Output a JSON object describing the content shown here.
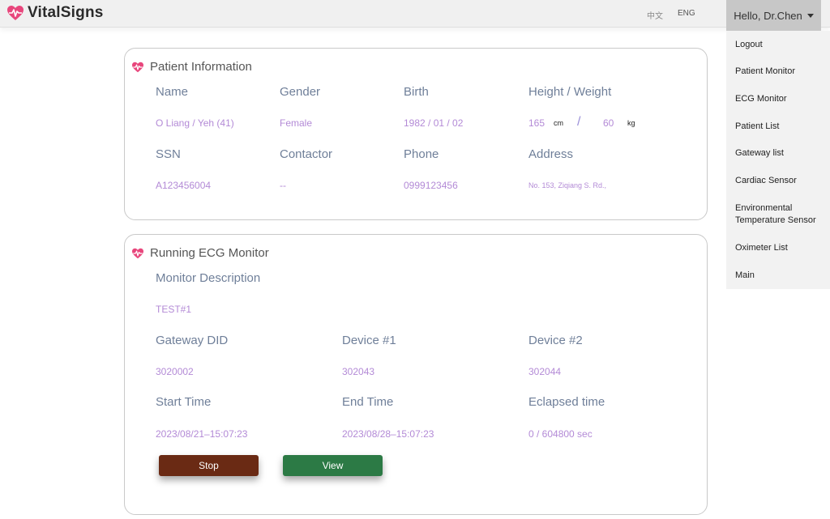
{
  "header": {
    "brand": "VitalSigns",
    "brand_icon": "heart-pulse-icon",
    "lang_zh": "中文",
    "lang_en": "ENG",
    "user_greeting": "Hello, Dr.Chen"
  },
  "menu": {
    "items": [
      "Logout",
      "Patient Monitor",
      "ECG Monitor",
      "Patient List",
      "Gateway list",
      "Cardiac Sensor",
      "Environmental Temperature Sensor",
      "Oximeter List",
      "Main"
    ]
  },
  "patient": {
    "title": "Patient Information",
    "name_label": "Name",
    "name_value": "O Liang / Yeh (41)",
    "gender_label": "Gender",
    "gender_value": "Female",
    "birth_label": "Birth",
    "birth_value": "1982 / 01 / 02",
    "hw_label": "Height / Weight",
    "height_value": "165",
    "height_unit": "cm",
    "hw_separator": "/",
    "weight_value": "60",
    "weight_unit": "kg",
    "ssn_label": "SSN",
    "ssn_value": "A123456004",
    "contactor_label": "Contactor",
    "contactor_value": "--",
    "phone_label": "Phone",
    "phone_value": "0999123456",
    "address_label": "Address",
    "address_value": "No. 153, Ziqiang S. Rd.,"
  },
  "ecg": {
    "title": "Running ECG Monitor",
    "desc_label": "Monitor Description",
    "desc_value": "TEST#1",
    "gateway_label": "Gateway DID",
    "gateway_value": "3020002",
    "device1_label": "Device #1",
    "device1_value": "302043",
    "device2_label": "Device #2",
    "device2_value": "302044",
    "start_label": "Start Time",
    "start_value": "2023/08/21–15:07:23",
    "end_label": "End Time",
    "end_value": "2023/08/28–15:07:23",
    "elapsed_label": "Eclapsed time",
    "elapsed_value": "0 / 604800 sec",
    "stop_label": "Stop",
    "view_label": "View"
  },
  "colors": {
    "accent_heart": "#e8467c",
    "stop_button": "#6a2a14",
    "view_button": "#2c7a45",
    "value_text": "#b38ad6"
  }
}
